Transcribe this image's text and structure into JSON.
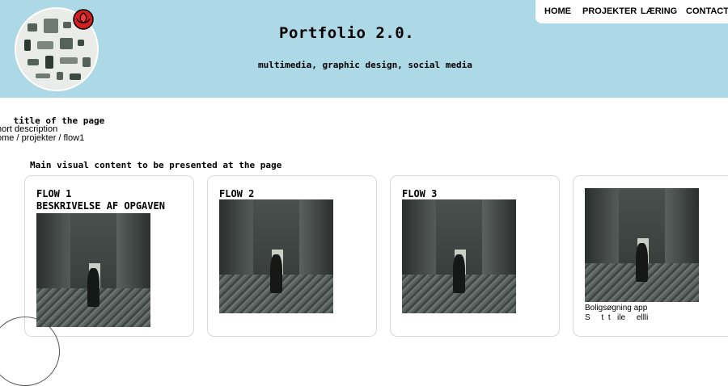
{
  "header": {
    "title": "Portfolio 2.0.",
    "subtitle": "multimedia, graphic design, social media",
    "background": "#add8e6"
  },
  "nav": {
    "items": [
      {
        "label": "HOME"
      },
      {
        "label": "PROJEKTER"
      },
      {
        "label": "LÆRING"
      },
      {
        "label": "CONTACT"
      }
    ]
  },
  "page": {
    "title": " title of the page",
    "description": "hort description",
    "breadcrumb": "ome / projekter / flow1",
    "main_label": "Main visual content to be presented at the page"
  },
  "cards": [
    {
      "title": "FLOW 1",
      "description": "BESKRIVELSE AF OPGAVEN"
    },
    {
      "title": "FLOW 2"
    },
    {
      "title": "FLOW 3"
    },
    {
      "caption": "Boligsøgning app",
      "caption2": "S     t  t   ile     ellli"
    }
  ]
}
